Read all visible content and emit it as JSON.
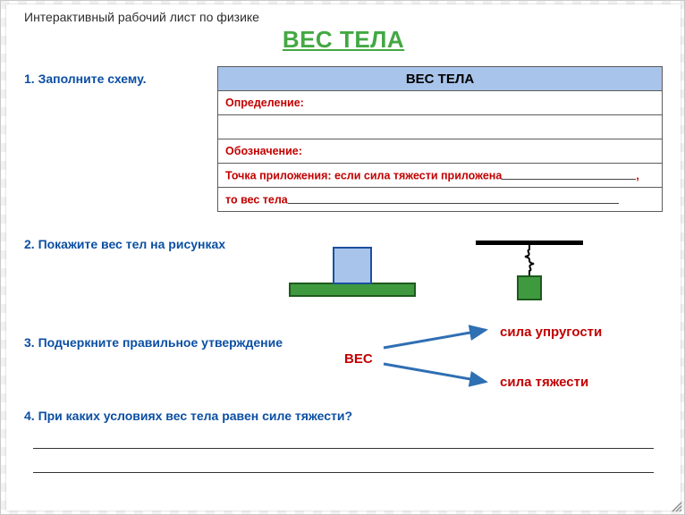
{
  "doc_title": "Интерактивный рабочий лист по физике",
  "main_title": "ВЕС ТЕЛА",
  "task1": {
    "label": "1. Заполните схему.",
    "table_header": "ВЕС ТЕЛА",
    "row_definition": "Определение:",
    "row_notation": "Обозначение:",
    "row_point_prefix": "Точка приложения: если сила тяжести приложена",
    "row_point_suffix": ",",
    "row_then_prefix": "то вес тела"
  },
  "task2": {
    "label": "2. Покажите вес тел на рисунках"
  },
  "task3": {
    "label": "3. Подчеркните правильное утверждение",
    "center": "ВЕС",
    "option1": "сила упругости",
    "option2": "сила тяжести"
  },
  "task4": {
    "label": "4. При каких условиях вес тела равен силе тяжести?"
  },
  "colors": {
    "accent_blue": "#0b4fa3",
    "accent_green": "#43a843",
    "danger_red": "#c20000",
    "table_header_bg": "#a9c4ea"
  }
}
